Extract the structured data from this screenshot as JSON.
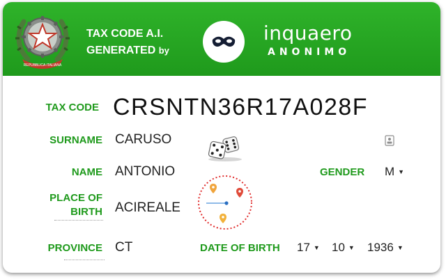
{
  "header": {
    "title_line1": "TAX CODE A.I.",
    "title_line2": "GENERATED",
    "title_by": "by",
    "brand_name": "inquaero",
    "brand_sub": "ANONIMO",
    "emblem_text": "REPUBBLICA ITALIANA",
    "colors": {
      "green": "#2fb32a",
      "green_dark": "#1f9a1c",
      "white": "#ffffff"
    }
  },
  "fields": {
    "tax_code_label": "TAX CODE",
    "tax_code_value": "CRSNTN36R17A028F",
    "surname_label": "SURNAME",
    "surname_value": "CARUSO",
    "name_label": "NAME",
    "name_value": "ANTONIO",
    "place_label_1": "PLACE OF",
    "place_label_2": "BIRTH",
    "place_value": "ACIREALE",
    "province_label": "PROVINCE",
    "province_value": "CT",
    "gender_label": "GENDER",
    "gender_value": "M",
    "dob_label": "DATE OF BIRTH",
    "dob_day": "17",
    "dob_month": "10",
    "dob_year": "1936"
  },
  "icons": {
    "dice": "dice-icon",
    "copy": "id-card-icon",
    "map": "map-pin-icon",
    "mask": "mask-icon"
  }
}
